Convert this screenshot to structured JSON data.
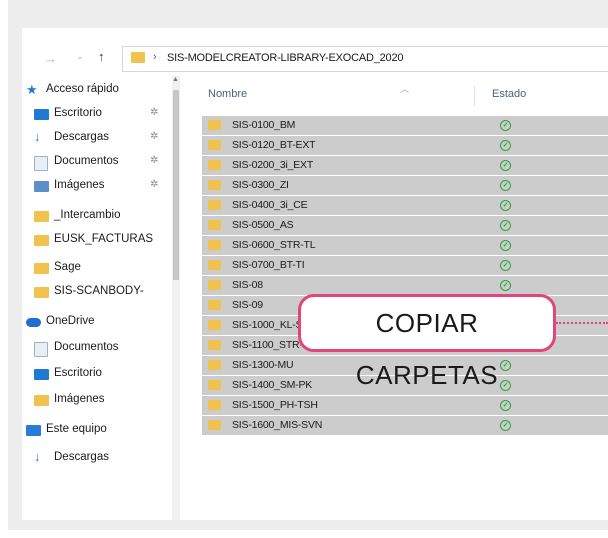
{
  "address": {
    "separator": "›",
    "path": "SIS-MODELCREATOR-LIBRARY-EXOCAD_2020"
  },
  "sidebar": {
    "items": [
      {
        "label": "Acceso rápido",
        "icon": "star-icon",
        "pinned": false
      },
      {
        "label": "Escritorio",
        "icon": "desktop-icon",
        "pinned": true
      },
      {
        "label": "Descargas",
        "icon": "download-icon",
        "pinned": true
      },
      {
        "label": "Documentos",
        "icon": "documents-icon",
        "pinned": true
      },
      {
        "label": "Imágenes",
        "icon": "images-icon",
        "pinned": true
      },
      {
        "label": "_Intercambio",
        "icon": "folder-icon",
        "pinned": false
      },
      {
        "label": "EUSK_FACTURAS",
        "icon": "folder-icon",
        "pinned": false
      },
      {
        "label": "Sage",
        "icon": "folder-icon",
        "pinned": false
      },
      {
        "label": "SIS-SCANBODY-",
        "icon": "folder-icon",
        "pinned": false
      },
      {
        "label": "OneDrive",
        "icon": "cloud-icon",
        "pinned": false
      },
      {
        "label": "Documentos",
        "icon": "documents-icon",
        "pinned": false
      },
      {
        "label": "Escritorio",
        "icon": "desktop-icon",
        "pinned": false
      },
      {
        "label": "Imágenes",
        "icon": "folder-icon",
        "pinned": false
      },
      {
        "label": "Este equipo",
        "icon": "computer-icon",
        "pinned": false
      },
      {
        "label": "Descargas",
        "icon": "download-icon",
        "pinned": false
      }
    ],
    "pin_glyph": "✲"
  },
  "columns": {
    "name": "Nombre",
    "state": "Estado"
  },
  "files": [
    {
      "name": "SIS-0100_BM"
    },
    {
      "name": "SIS-0120_BT-EXT"
    },
    {
      "name": "SIS-0200_3i_EXT"
    },
    {
      "name": "SIS-0300_ZI"
    },
    {
      "name": "SIS-0400_3i_CE"
    },
    {
      "name": "SIS-0500_AS"
    },
    {
      "name": "SIS-0600_STR-TL"
    },
    {
      "name": "SIS-0700_BT-TI"
    },
    {
      "name": "SIS-08"
    },
    {
      "name": "SIS-09"
    },
    {
      "name": "SIS-1000_KL-SKZ"
    },
    {
      "name": "SIS-1100_STR-BL"
    },
    {
      "name": "SIS-1300-MU"
    },
    {
      "name": "SIS-1400_SM-PK"
    },
    {
      "name": "SIS-1500_PH-TSH"
    },
    {
      "name": "SIS-1600_MIS-SVN"
    }
  ],
  "status_glyph": "✓",
  "callout": {
    "text": "COPIAR CARPETAS"
  },
  "colors": {
    "accent": "#e2457a",
    "folder": "#f1c24d",
    "selected_row": "#cccccc",
    "status_ok": "#27a33e"
  }
}
